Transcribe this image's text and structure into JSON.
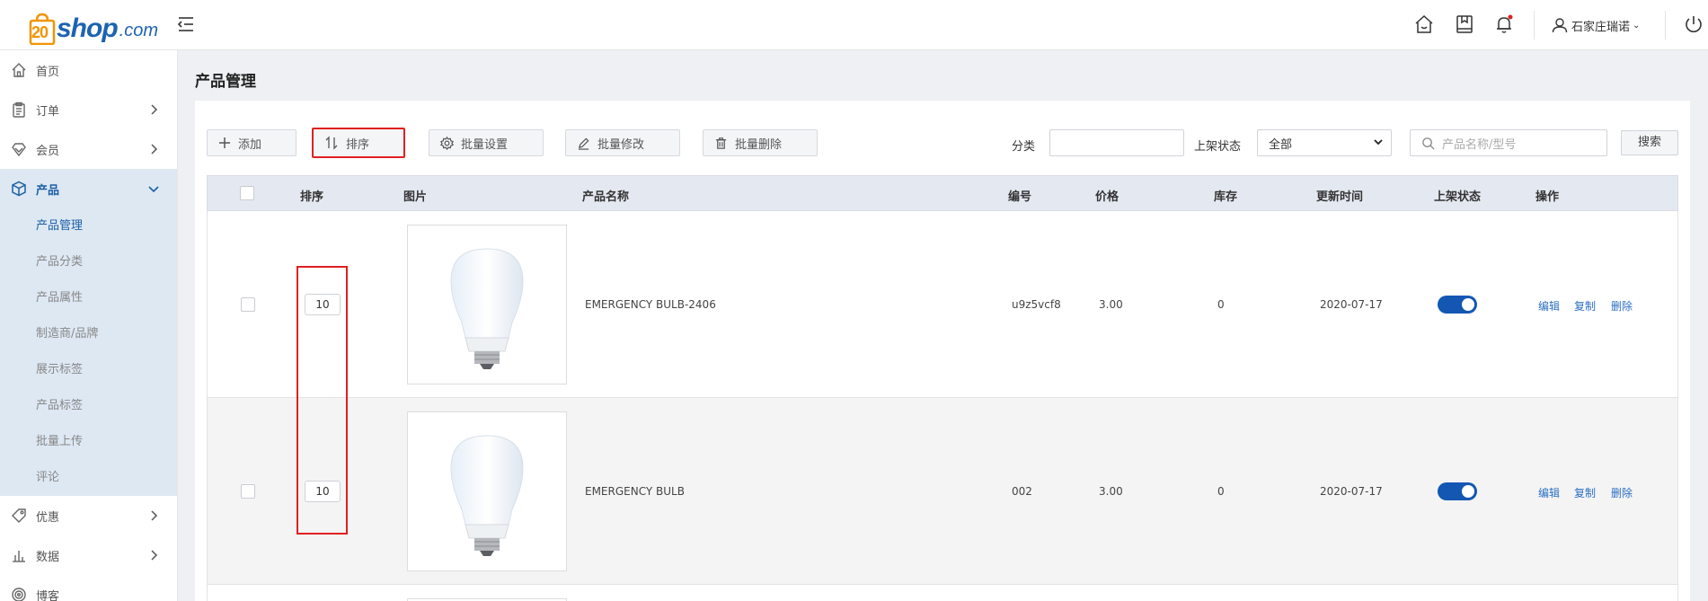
{
  "app": {
    "logo_number": "20",
    "logo_text": "shop",
    "logo_suffix": ".com"
  },
  "header": {
    "user_name": "石家庄瑞诺",
    "user_chevron": "⌄"
  },
  "sidebar": {
    "items": [
      {
        "label": "首页",
        "icon": "home-icon"
      },
      {
        "label": "订单",
        "icon": "clipboard-icon"
      },
      {
        "label": "会员",
        "icon": "diamond-icon"
      },
      {
        "label": "产品",
        "icon": "cube-icon"
      },
      {
        "label": "优惠",
        "icon": "tag-icon"
      },
      {
        "label": "数据",
        "icon": "bar-chart-icon"
      },
      {
        "label": "博客",
        "icon": "spiral-icon"
      }
    ],
    "product_sub_items": [
      "产品管理",
      "产品分类",
      "产品属性",
      "制造商/品牌",
      "展示标签",
      "产品标签",
      "批量上传",
      "评论"
    ]
  },
  "page": {
    "title": "产品管理"
  },
  "toolbar": {
    "add": "添加",
    "sort": "排序",
    "batch_settings": "批量设置",
    "batch_edit": "批量修改",
    "batch_delete": "批量删除"
  },
  "filters": {
    "category_label": "分类",
    "category_value": "",
    "status_label": "上架状态",
    "status_value": "全部",
    "search_placeholder": "产品名称/型号",
    "search_button": "搜索"
  },
  "table": {
    "headers": {
      "sort": "排序",
      "image": "图片",
      "name": "产品名称",
      "code": "编号",
      "price": "价格",
      "stock": "库存",
      "updated": "更新时间",
      "status": "上架状态",
      "actions": "操作"
    },
    "rows": [
      {
        "sort": "10",
        "name": "EMERGENCY BULB-2406",
        "code": "u9z5vcf8",
        "price": "3.00",
        "stock": "0",
        "updated": "2020-07-17",
        "on_shelf": true
      },
      {
        "sort": "10",
        "name": "EMERGENCY BULB",
        "code": "002",
        "price": "3.00",
        "stock": "0",
        "updated": "2020-07-17",
        "on_shelf": true
      }
    ],
    "actions": {
      "edit": "编辑",
      "copy": "复制",
      "delete": "删除"
    }
  },
  "colors": {
    "brand_blue": "#1d63b0",
    "logo_orange": "#f29400",
    "toggle_on": "#1357b3",
    "link": "#2b6fc2",
    "highlight_red": "#e02020",
    "sidebar_active_bg": "#dde8f3"
  }
}
